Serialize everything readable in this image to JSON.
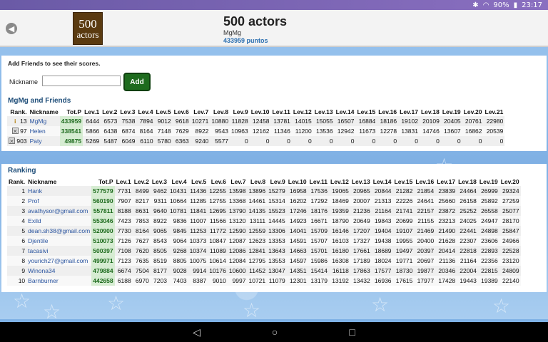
{
  "status": {
    "battery": "90%",
    "time": "23:17"
  },
  "header": {
    "title": "500 actors",
    "user": "MgMg",
    "points": "433959 puntos",
    "logo_line1": "500",
    "logo_line2": "actors"
  },
  "friends_panel": {
    "add_text": "Add Friends to see their scores.",
    "nickname_label": "Nickname",
    "nickname_value": "",
    "add_button": "Add",
    "section_title": "MgMg and Friends",
    "columns": [
      "Rank.",
      "Nickname",
      "Tot.P",
      "Lev.1",
      "Lev.2",
      "Lev.3",
      "Lev.4",
      "Lev.5",
      "Lev.6",
      "Lev.7",
      "Lev.8",
      "Lev.9",
      "Lev.10",
      "Lev.11",
      "Lev.12",
      "Lev.13",
      "Lev.14",
      "Lev.15",
      "Lev.16",
      "Lev.17",
      "Lev.18",
      "Lev.19",
      "Lev.20",
      "Lev.21"
    ],
    "rows": [
      {
        "icon": "info-icon",
        "rank": "13",
        "name": "MgMg",
        "total": "433959",
        "levels": [
          "6444",
          "6573",
          "7538",
          "7894",
          "9012",
          "9618",
          "10271",
          "10880",
          "11828",
          "12458",
          "13781",
          "14015",
          "15055",
          "16507",
          "16884",
          "18186",
          "19102",
          "20109",
          "20405",
          "20761",
          "22980"
        ]
      },
      {
        "icon": "remove-icon",
        "rank": "97",
        "name": "Helen",
        "total": "338541",
        "levels": [
          "5866",
          "6438",
          "6874",
          "8164",
          "7148",
          "7629",
          "8922",
          "9543",
          "10963",
          "12162",
          "11346",
          "11200",
          "13536",
          "12942",
          "11673",
          "12278",
          "13831",
          "14746",
          "13607",
          "16862",
          "20539"
        ]
      },
      {
        "icon": "remove-icon",
        "rank": "903",
        "name": "Paty",
        "total": "49875",
        "levels": [
          "5269",
          "5487",
          "6049",
          "6110",
          "5780",
          "6363",
          "9240",
          "5577",
          "0",
          "0",
          "0",
          "0",
          "0",
          "0",
          "0",
          "0",
          "0",
          "0",
          "0",
          "0",
          "0"
        ]
      }
    ]
  },
  "ranking_panel": {
    "section_title": "Ranking",
    "columns": [
      "Rank.",
      "Nickname",
      "Tot.P",
      "Lev.1",
      "Lev.2",
      "Lev.3",
      "Lev.4",
      "Lev.5",
      "Lev.6",
      "Lev.7",
      "Lev.8",
      "Lev.9",
      "Lev.10",
      "Lev.11",
      "Lev.12",
      "Lev.13",
      "Lev.14",
      "Lev.15",
      "Lev.16",
      "Lev.17",
      "Lev.18",
      "Lev.19",
      "Lev.20"
    ],
    "rows": [
      {
        "rank": "1",
        "name": "Hank",
        "total": "577579",
        "levels": [
          "7731",
          "8499",
          "9462",
          "10431",
          "11436",
          "12255",
          "13598",
          "13896",
          "15279",
          "16958",
          "17536",
          "19065",
          "20965",
          "20844",
          "21282",
          "21854",
          "23839",
          "24464",
          "26999",
          "29324"
        ]
      },
      {
        "rank": "2",
        "name": "Prof",
        "total": "560190",
        "levels": [
          "7907",
          "8217",
          "9311",
          "10664",
          "11285",
          "12755",
          "13368",
          "14461",
          "15314",
          "16202",
          "17292",
          "18469",
          "20007",
          "21313",
          "22226",
          "24641",
          "25660",
          "26158",
          "25892",
          "27259"
        ]
      },
      {
        "rank": "3",
        "name": "avathysor@gmail.com",
        "total": "557811",
        "levels": [
          "8188",
          "8631",
          "9640",
          "10781",
          "11841",
          "12695",
          "13790",
          "14135",
          "15523",
          "17246",
          "18176",
          "19359",
          "21236",
          "21164",
          "21741",
          "22157",
          "23872",
          "25252",
          "26558",
          "25077"
        ]
      },
      {
        "rank": "4",
        "name": "Exild",
        "total": "553046",
        "levels": [
          "7423",
          "7853",
          "8922",
          "9836",
          "11007",
          "11566",
          "13120",
          "13111",
          "14445",
          "14923",
          "16671",
          "18790",
          "20649",
          "19843",
          "20699",
          "21155",
          "23213",
          "24025",
          "24947",
          "28170"
        ]
      },
      {
        "rank": "5",
        "name": "dean.sh38@gmail.com",
        "total": "520900",
        "levels": [
          "7730",
          "8164",
          "9065",
          "9845",
          "11253",
          "11772",
          "12590",
          "12559",
          "13306",
          "14041",
          "15709",
          "16146",
          "17207",
          "19404",
          "19107",
          "21469",
          "21490",
          "22441",
          "24898",
          "25847"
        ]
      },
      {
        "rank": "6",
        "name": "Djentile",
        "total": "510073",
        "levels": [
          "7126",
          "7627",
          "8543",
          "9064",
          "10373",
          "10847",
          "12087",
          "12623",
          "13353",
          "14591",
          "15707",
          "16103",
          "17327",
          "19438",
          "19955",
          "20400",
          "21628",
          "22307",
          "23606",
          "24966"
        ]
      },
      {
        "rank": "7",
        "name": "tacasivi",
        "total": "500397",
        "levels": [
          "7108",
          "7620",
          "8505",
          "9268",
          "10374",
          "11089",
          "12086",
          "12841",
          "13643",
          "14663",
          "15701",
          "16180",
          "17661",
          "18689",
          "19497",
          "20397",
          "20414",
          "22818",
          "22893",
          "22528"
        ]
      },
      {
        "rank": "8",
        "name": "yourich27@gmail.com",
        "total": "499971",
        "levels": [
          "7123",
          "7635",
          "8519",
          "8805",
          "10075",
          "10614",
          "12084",
          "12795",
          "13553",
          "14597",
          "15986",
          "16308",
          "17189",
          "18024",
          "19771",
          "20697",
          "21136",
          "21164",
          "22356",
          "23120"
        ]
      },
      {
        "rank": "9",
        "name": "Winona34",
        "total": "479884",
        "levels": [
          "6674",
          "7504",
          "8177",
          "9028",
          "9914",
          "10176",
          "10600",
          "11452",
          "13047",
          "14351",
          "15414",
          "16118",
          "17863",
          "17577",
          "18730",
          "19877",
          "20346",
          "22004",
          "22815",
          "24809"
        ]
      },
      {
        "rank": "10",
        "name": "Barnburner",
        "total": "442658",
        "levels": [
          "6188",
          "6970",
          "7203",
          "7403",
          "8387",
          "9010",
          "9997",
          "10721",
          "11079",
          "12301",
          "13179",
          "13192",
          "13432",
          "16936",
          "17615",
          "17977",
          "17428",
          "19443",
          "19389",
          "22140"
        ]
      }
    ]
  }
}
